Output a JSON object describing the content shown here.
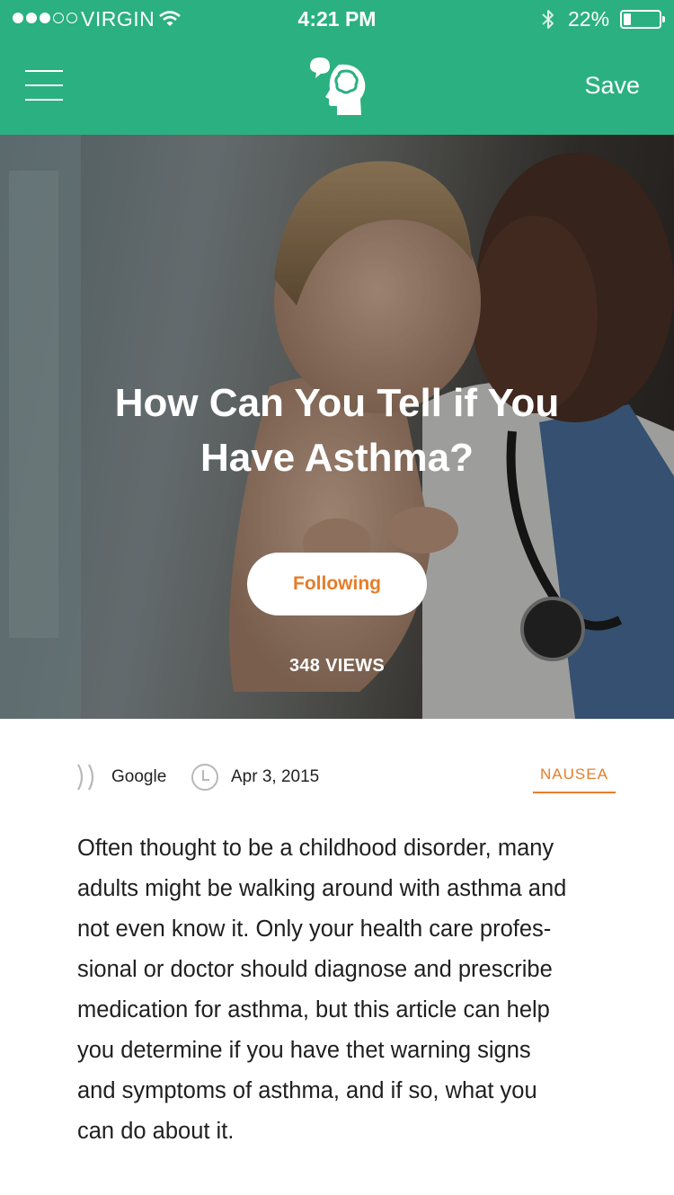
{
  "status_bar": {
    "carrier": "VIRGIN",
    "time": "4:21 PM",
    "battery": "22%",
    "battery_level": 0.22,
    "signal_bars": 3
  },
  "header": {
    "menu_icon": "hamburger-menu-icon",
    "logo_icon": "head-speech-bubble-logo",
    "save_label": "Save",
    "color": "#2bb081"
  },
  "hero": {
    "title": "How Can You Tell if You Have Asthma?",
    "follow_label": "Following",
    "views": "348 VIEWS",
    "follow_color": "#e57d2a"
  },
  "meta": {
    "source_icon": "source-icon",
    "source": "Google",
    "date_icon": "clock-icon",
    "date": "Apr 3, 2015",
    "tag": "NAUSEA"
  },
  "article": {
    "body": "Often thought to be a childhood disorder, many\nadults might be walking around with asthma and\nnot even know it. Only your health care profes-\nsional or doctor should diagnose and prescribe\nmedication for asthma, but this article can help\nyou determine if you have thet warning signs\nand symptoms of asthma, and if so, what you\ncan do about it."
  }
}
